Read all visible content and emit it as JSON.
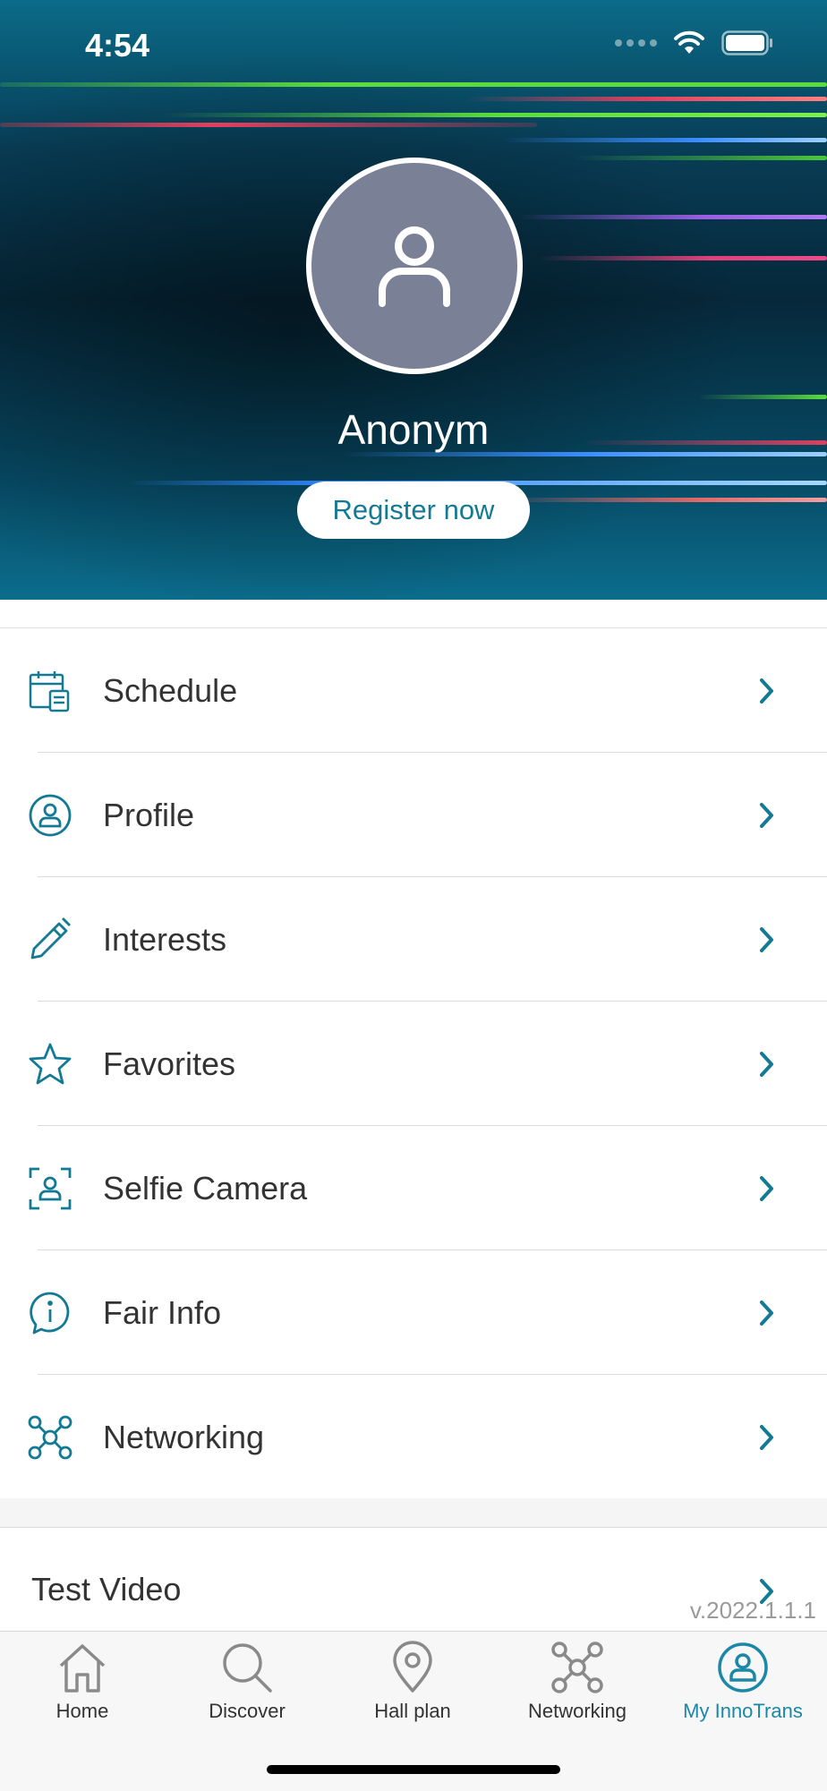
{
  "status_bar": {
    "time": "4:54"
  },
  "profile": {
    "name": "Anonym",
    "register_label": "Register now"
  },
  "menu": {
    "items": [
      {
        "label": "Schedule",
        "icon": "calendar-icon"
      },
      {
        "label": "Profile",
        "icon": "user-circle-icon"
      },
      {
        "label": "Interests",
        "icon": "pencil-icon"
      },
      {
        "label": "Favorites",
        "icon": "star-icon"
      },
      {
        "label": "Selfie Camera",
        "icon": "selfie-camera-icon"
      },
      {
        "label": "Fair Info",
        "icon": "info-bubble-icon"
      },
      {
        "label": "Networking",
        "icon": "network-icon"
      }
    ]
  },
  "test_video": {
    "label": "Test Video"
  },
  "version": "v.2022.1.1.1",
  "tabbar": {
    "tabs": [
      {
        "label": "Home",
        "icon": "home-icon"
      },
      {
        "label": "Discover",
        "icon": "search-icon"
      },
      {
        "label": "Hall plan",
        "icon": "location-pin-icon"
      },
      {
        "label": "Networking",
        "icon": "network-icon"
      },
      {
        "label": "My InnoTrans",
        "icon": "user-circle-icon",
        "active": true
      }
    ]
  },
  "colors": {
    "accent": "#137a94",
    "hero_dark": "#06283a",
    "hero_light": "#0b6d8c"
  }
}
